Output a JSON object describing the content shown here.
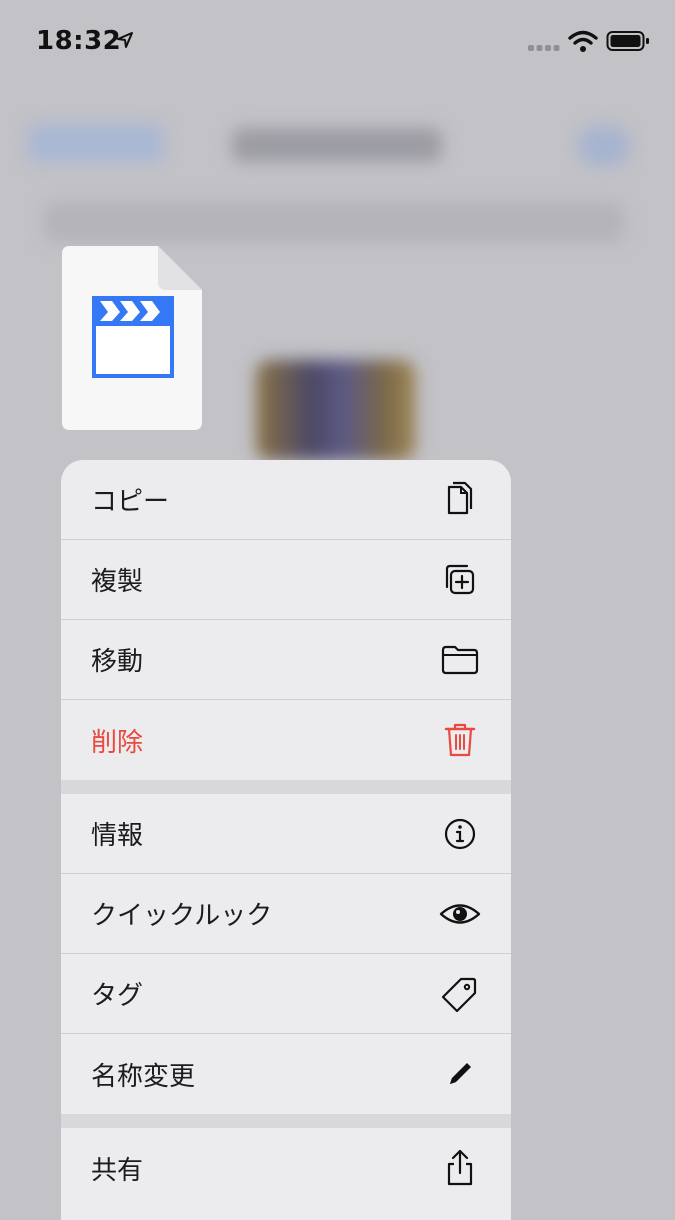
{
  "status_bar": {
    "time": "18:32"
  },
  "menu": {
    "groups": [
      [
        {
          "label": "コピー",
          "icon": "copy-icon"
        },
        {
          "label": "複製",
          "icon": "duplicate-icon"
        },
        {
          "label": "移動",
          "icon": "folder-icon"
        },
        {
          "label": "削除",
          "icon": "trash-icon",
          "destructive": true
        }
      ],
      [
        {
          "label": "情報",
          "icon": "info-icon"
        },
        {
          "label": "クイックルック",
          "icon": "eye-icon"
        },
        {
          "label": "タグ",
          "icon": "tag-icon"
        },
        {
          "label": "名称変更",
          "icon": "pencil-icon"
        }
      ],
      [
        {
          "label": "共有",
          "icon": "share-icon"
        }
      ]
    ]
  },
  "colors": {
    "destructive": "#e9493f",
    "accent": "#3478f6"
  }
}
